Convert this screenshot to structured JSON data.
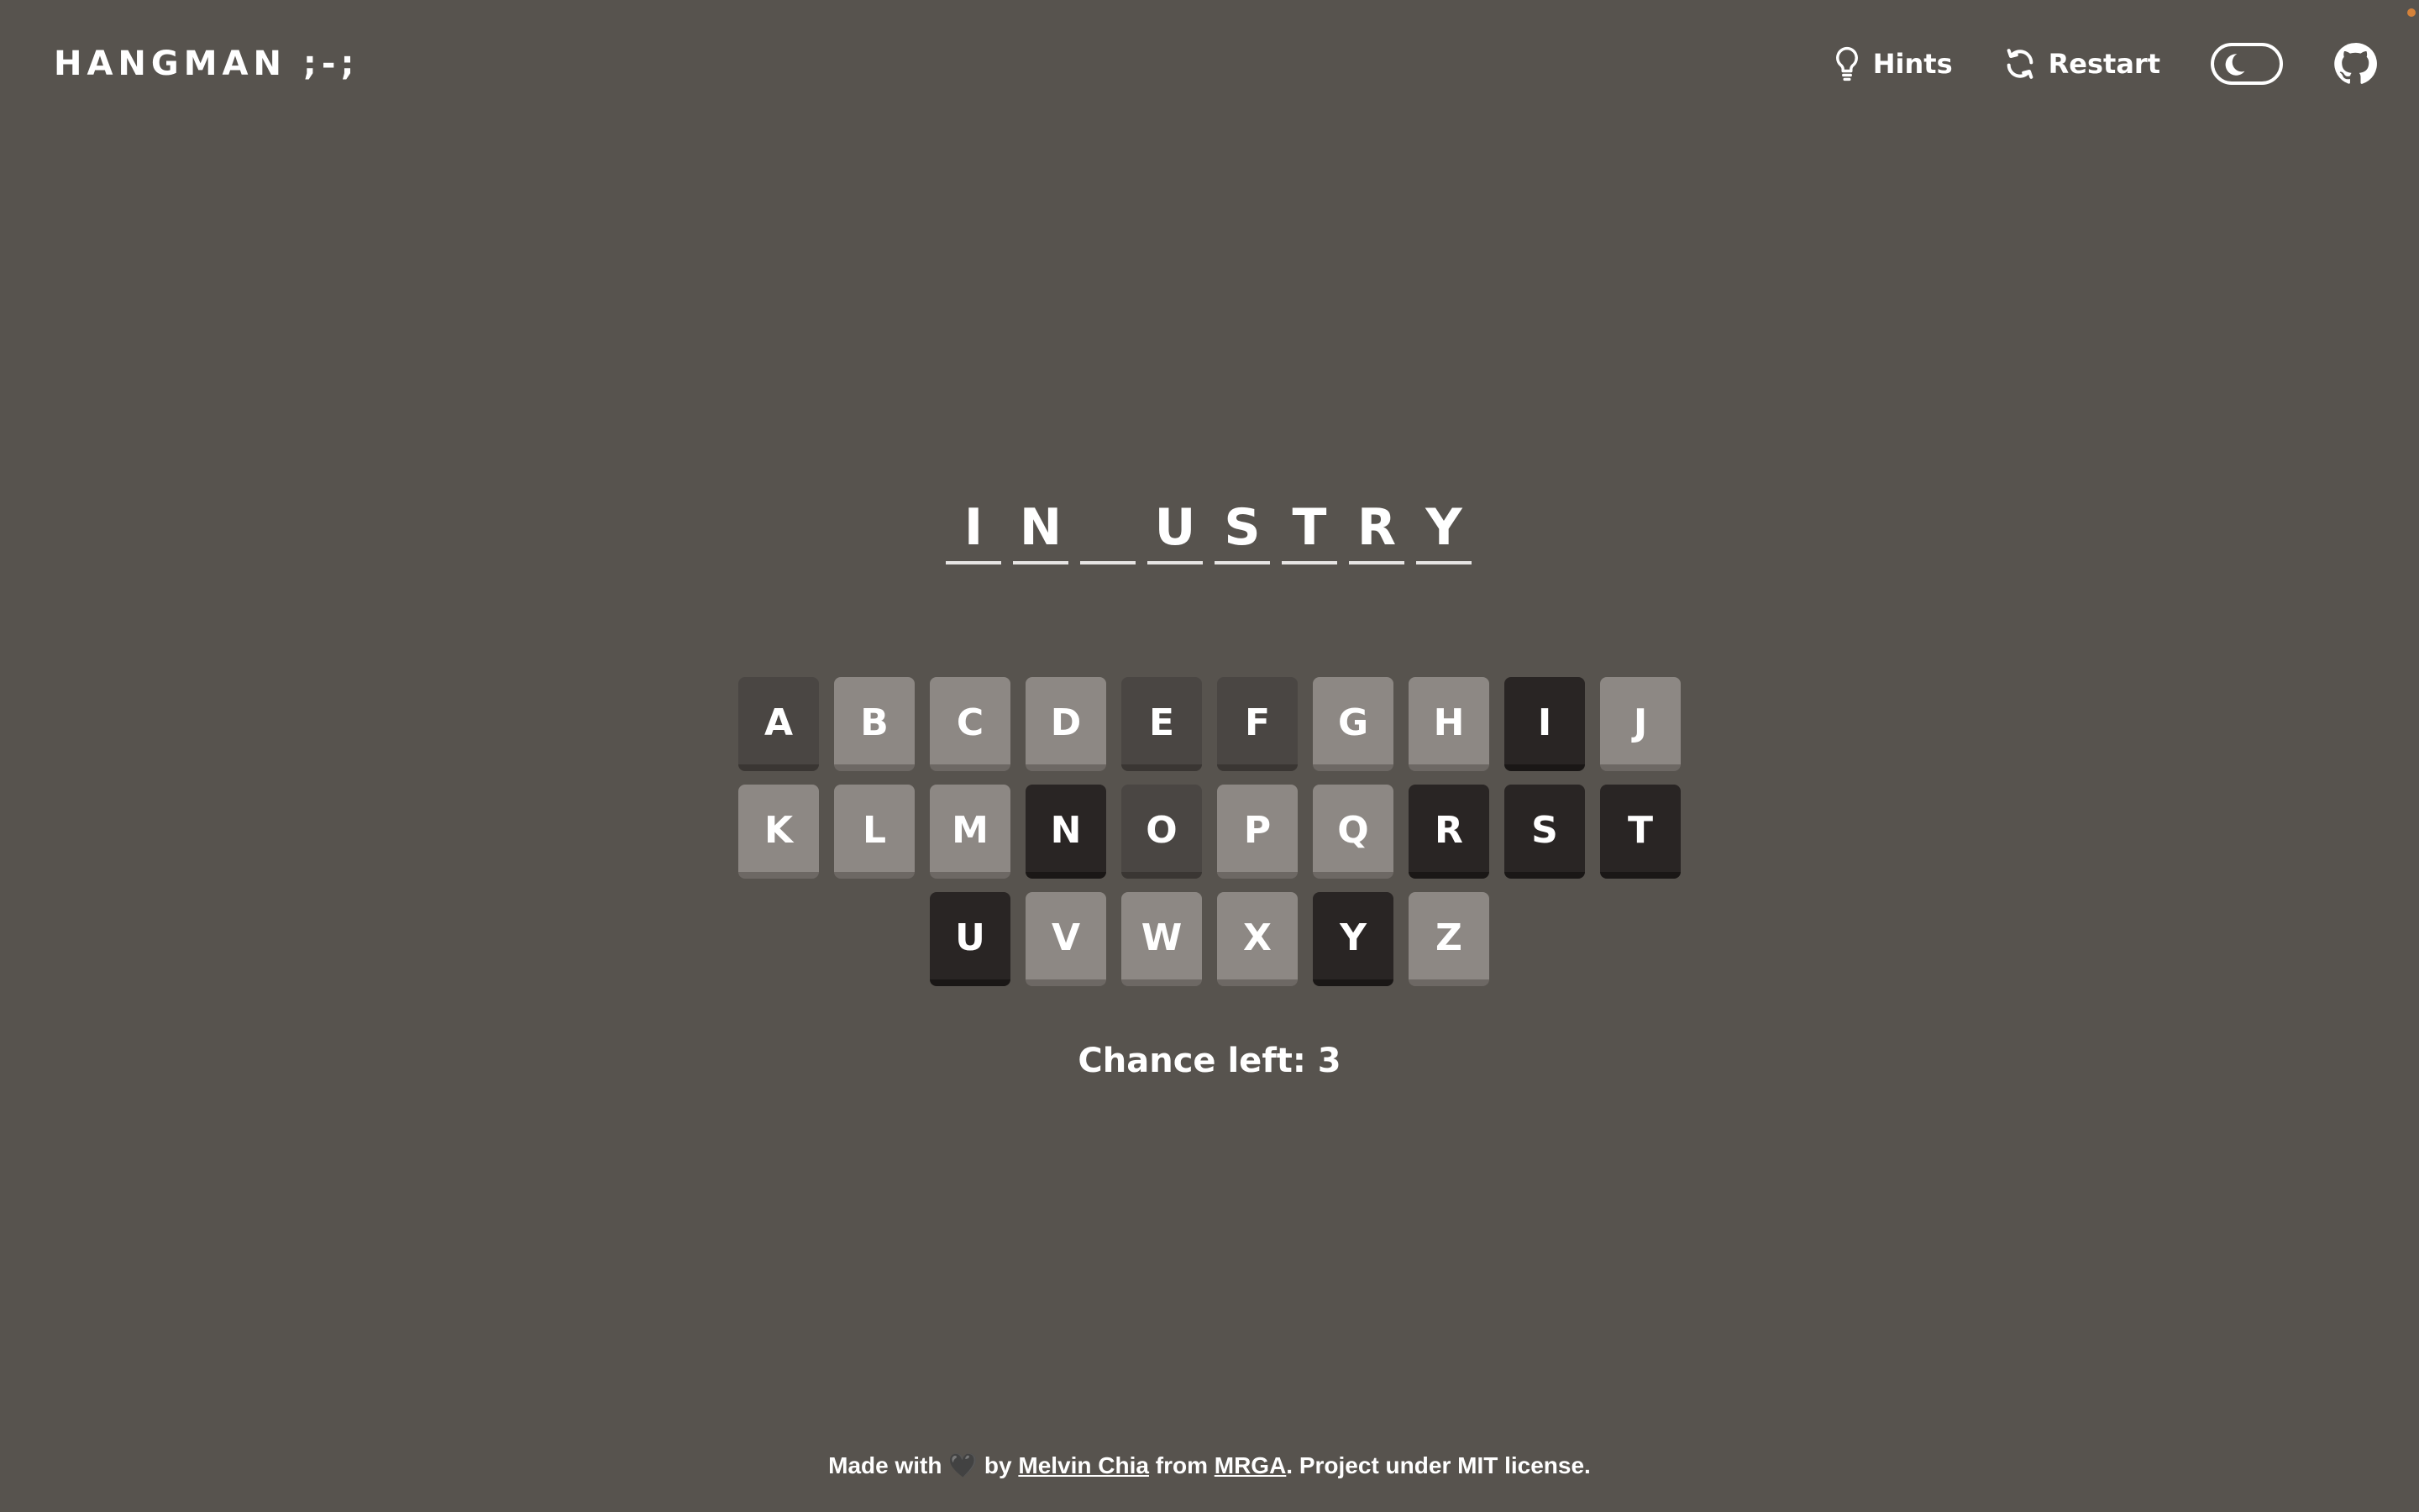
{
  "header": {
    "title": "HANGMAN ;-;",
    "hints_label": "Hints",
    "restart_label": "Restart"
  },
  "word": {
    "slots": [
      "I",
      "N",
      "",
      "U",
      "S",
      "T",
      "R",
      "Y"
    ]
  },
  "keyboard": {
    "rows": [
      [
        {
          "letter": "A",
          "state": "wrong"
        },
        {
          "letter": "B",
          "state": "unused"
        },
        {
          "letter": "C",
          "state": "unused"
        },
        {
          "letter": "D",
          "state": "unused"
        },
        {
          "letter": "E",
          "state": "wrong"
        },
        {
          "letter": "F",
          "state": "wrong"
        },
        {
          "letter": "G",
          "state": "unused"
        },
        {
          "letter": "H",
          "state": "unused"
        },
        {
          "letter": "I",
          "state": "correct"
        },
        {
          "letter": "J",
          "state": "unused"
        }
      ],
      [
        {
          "letter": "K",
          "state": "unused"
        },
        {
          "letter": "L",
          "state": "unused"
        },
        {
          "letter": "M",
          "state": "unused"
        },
        {
          "letter": "N",
          "state": "correct"
        },
        {
          "letter": "O",
          "state": "wrong"
        },
        {
          "letter": "P",
          "state": "unused"
        },
        {
          "letter": "Q",
          "state": "unused"
        },
        {
          "letter": "R",
          "state": "correct"
        },
        {
          "letter": "S",
          "state": "correct"
        },
        {
          "letter": "T",
          "state": "correct"
        }
      ],
      [
        {
          "letter": "U",
          "state": "correct"
        },
        {
          "letter": "V",
          "state": "unused"
        },
        {
          "letter": "W",
          "state": "unused"
        },
        {
          "letter": "X",
          "state": "unused"
        },
        {
          "letter": "Y",
          "state": "correct"
        },
        {
          "letter": "Z",
          "state": "unused"
        }
      ]
    ]
  },
  "status": {
    "chances_text": "Chance left: 3"
  },
  "footer": {
    "prefix": "Made with ",
    "heart": "🖤",
    "by": " by ",
    "author": "Melvin Chia",
    "from": " from ",
    "org": "MRGA",
    "suffix": ". Project under MIT license."
  },
  "colors": {
    "background": "#57534e",
    "key_unused": "#8d8884",
    "key_wrong": "#4a4643",
    "key_correct": "#292524"
  },
  "icons": [
    "lightbulb-icon",
    "restart-icon",
    "moon-icon",
    "github-icon"
  ]
}
